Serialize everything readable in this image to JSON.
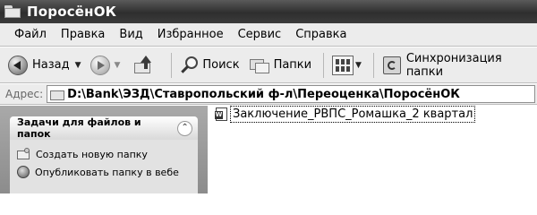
{
  "window": {
    "title": "ПоросёнОК"
  },
  "menu": {
    "items": [
      "Файл",
      "Правка",
      "Вид",
      "Избранное",
      "Сервис",
      "Справка"
    ]
  },
  "toolbar": {
    "back_label": "Назад",
    "search_label": "Поиск",
    "folders_label": "Папки",
    "sync_label": "Синхронизация папки"
  },
  "address": {
    "label": "Адрес:",
    "path": "D:\\Bank\\ЭЗД\\Ставропольский ф-л\\Переоценка\\ПоросёнОК"
  },
  "taskpane": {
    "title": "Задачи для файлов и папок",
    "links": [
      {
        "label": "Создать новую папку",
        "icon": "new-folder-icon"
      },
      {
        "label": "Опубликовать папку в вебе",
        "icon": "web-publish-icon"
      }
    ]
  },
  "files": [
    {
      "name": "Заключение_РВПС_Ромашка_2 квартал",
      "icon": "word-document-icon",
      "selected": true
    }
  ]
}
